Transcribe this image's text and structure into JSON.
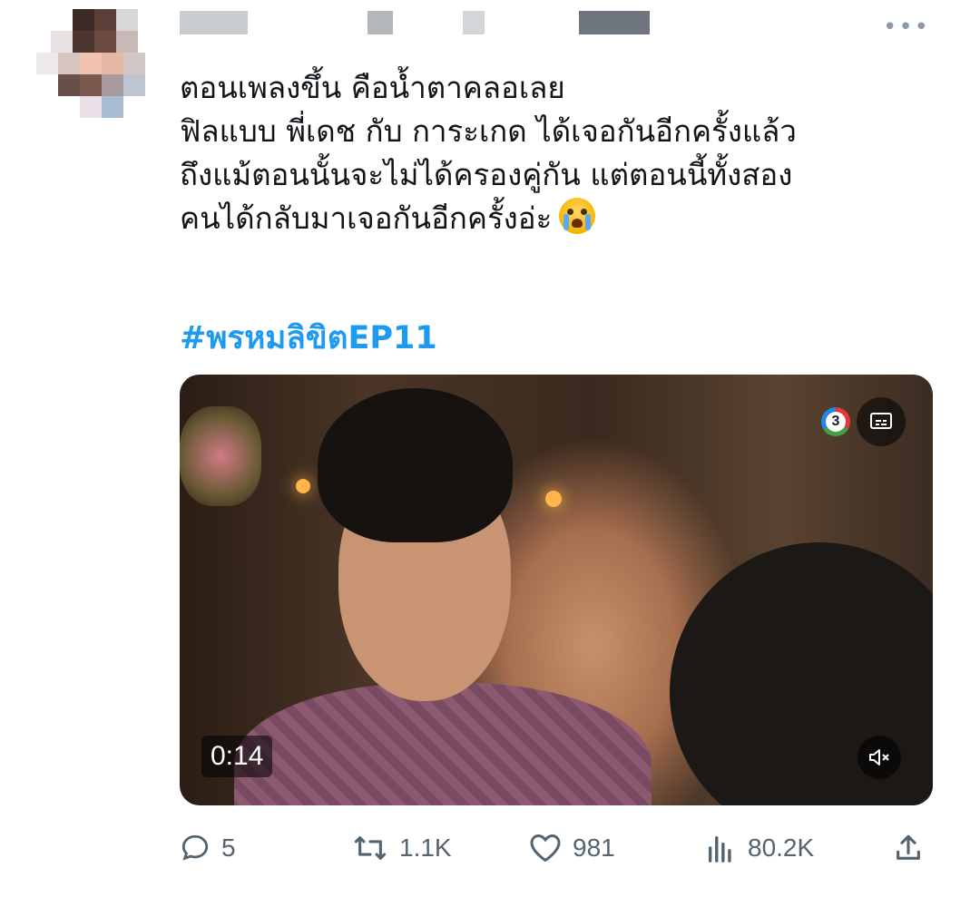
{
  "tweet": {
    "lines": [
      "ตอนเพลงขึ้น คือน้ำตาคลอเลย",
      "ฟิลแบบ พี่เดช กับ การะเกด ได้เจอกันอีกครั้งแล้ว",
      "ถึงแม้ตอนนั้นจะไม่ได้ครองคู่กัน แต่ตอนนี้ทั้งสอง",
      "คนได้กลับมาเจอกันอีกครั้งอ่ะ"
    ],
    "emoji": "loudly-crying-face",
    "hashtag": "#พรหมลิขิตEP11"
  },
  "video": {
    "duration": "0:14",
    "channel_logo": "3",
    "cc_icon": "subtitles-icon",
    "mute_icon": "muted-speaker-icon"
  },
  "actions": {
    "replies": "5",
    "retweets": "1.1K",
    "likes": "981",
    "views": "80.2K"
  },
  "colors": {
    "link": "#1d9bf0",
    "muted": "#536471",
    "text": "#0f1419"
  }
}
